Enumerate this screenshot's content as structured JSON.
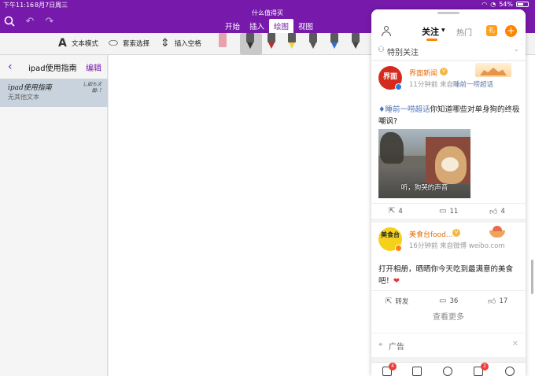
{
  "status_bar": {
    "time": "下午11:16",
    "date": "8月7日周三",
    "battery": "54%"
  },
  "onenote": {
    "document_title": "什么值得买",
    "tabs": [
      {
        "label": "开始",
        "active": false
      },
      {
        "label": "插入",
        "active": false
      },
      {
        "label": "绘图",
        "active": true
      },
      {
        "label": "视图",
        "active": false
      }
    ],
    "ribbon": {
      "text_mode": "文本模式",
      "lasso_select": "套索选择",
      "insert_space": "插入空格",
      "pens": [
        {
          "name": "eraser",
          "color": "#e7a3a9"
        },
        {
          "name": "black-pen",
          "color": "#333333",
          "selected": true
        },
        {
          "name": "red-pen",
          "color": "#c22a2a"
        },
        {
          "name": "yellow-highlighter",
          "color": "#f1d33b"
        },
        {
          "name": "gray-pen",
          "color": "#555555"
        },
        {
          "name": "blue-pen",
          "color": "#2f6fd1"
        },
        {
          "name": "dark-pen",
          "color": "#444444"
        }
      ]
    },
    "pages_panel": {
      "section_title": "ipad使用指南",
      "edit_label": "编辑",
      "pages": [
        {
          "title": "ipad使用指南",
          "subtitle": "无其他文本",
          "date_line1": "し如ちズ",
          "date_line2": "甜: !"
        }
      ]
    }
  },
  "weibo": {
    "tab_follow": "关注",
    "tab_hot": "热门",
    "special_follow": "特别关注",
    "posts": [
      {
        "account": "界面新闻",
        "avatar_text": "界面",
        "time": "11分钟前",
        "source_prefix": "来自",
        "source": "睡前一唠超话",
        "topic": "睡前一唠超话",
        "text": "你知道哪些对单身狗的终极嘲讽?",
        "image_caption": "听，狗哭的声音",
        "reposts": "4",
        "comments": "11",
        "likes": "4"
      },
      {
        "account": "美食台food...",
        "avatar_text": "美食台",
        "time": "16分钟前",
        "source_prefix": "来自微博",
        "source": "weibo.com",
        "text": "打开相册，晒晒你今天吃到最满意的美食吧！",
        "repost_label": "转发",
        "comments": "36",
        "likes": "17"
      }
    ],
    "see_more": "查看更多",
    "ad_label": "广告",
    "nav_badges": [
      "4",
      "2"
    ],
    "colors": {
      "accent": "#ff8200",
      "link": "#4c73b8",
      "name": "#e86b00"
    }
  },
  "theme": {
    "onenote_purple": "#7719aa"
  }
}
